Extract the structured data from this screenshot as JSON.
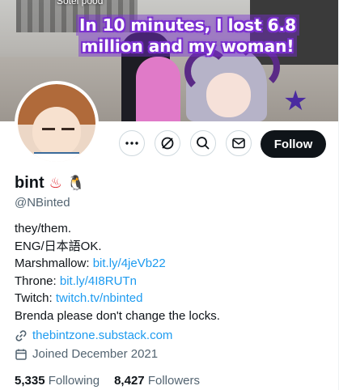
{
  "banner": {
    "caption_line1": "In 10 minutes, I lost 6.8",
    "caption_line2": "million and my woman!",
    "top_cropped_text": "Sotel pood"
  },
  "actions": {
    "more_icon": "more-horizontal-icon",
    "grok_icon": "grok-icon",
    "search_icon": "search-icon",
    "message_icon": "envelope-icon",
    "follow_label": "Follow"
  },
  "profile": {
    "name": "bint",
    "name_emoji_1": "♨",
    "name_emoji_2": "🐧",
    "handle": "@NBinted"
  },
  "bio": {
    "line1": "they/them.",
    "line2": "ENG/日本語OK.",
    "marshmallow_label": "Marshmallow: ",
    "marshmallow_link": "bit.ly/4jeVb22",
    "throne_label": "Throne: ",
    "throne_link": "bit.ly/4I8RUTn",
    "twitch_label": "Twitch: ",
    "twitch_link": "twitch.tv/nbinted",
    "line6": "Brenda please don't change the locks."
  },
  "meta": {
    "website": "thebintzone.substack.com",
    "joined": "Joined December 2021"
  },
  "stats": {
    "following_count": "5,335",
    "following_label": "Following",
    "followers_count": "8,427",
    "followers_label": "Followers"
  },
  "colors": {
    "link": "#1d9bf0",
    "text": "#0f1419",
    "secondary": "#536471",
    "follow_bg": "#0f1419"
  }
}
